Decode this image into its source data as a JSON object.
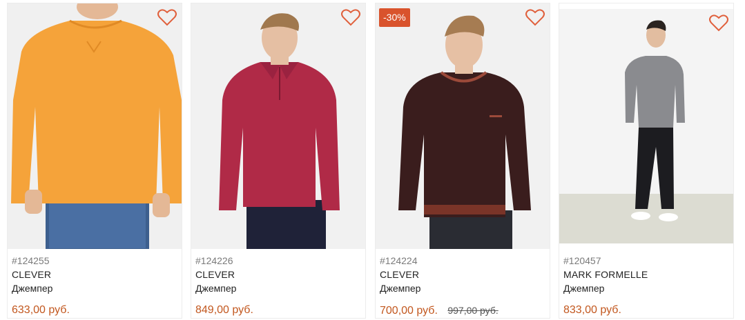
{
  "products": [
    {
      "sku": "#124255",
      "brand": "CLEVER",
      "type": "Джемпер",
      "price": "633,00 руб.",
      "old_price": "",
      "discount": "",
      "image": "orange-sweater-man",
      "icon": "heart-icon"
    },
    {
      "sku": "#124226",
      "brand": "CLEVER",
      "type": "Джемпер",
      "price": "849,00 руб.",
      "old_price": "",
      "discount": "",
      "image": "burgundy-polo-sweater-man",
      "icon": "heart-icon"
    },
    {
      "sku": "#124224",
      "brand": "CLEVER",
      "type": "Джемпер",
      "price": "700,00 руб.",
      "old_price": "997,00 руб.",
      "discount": "-30%",
      "image": "dark-brown-sweater-man",
      "icon": "heart-icon"
    },
    {
      "sku": "#120457",
      "brand": "MARK FORMELLE",
      "type": "Джемпер",
      "price": "833,00 руб.",
      "old_price": "",
      "discount": "",
      "image": "grey-sweater-man-full-length",
      "icon": "heart-icon"
    }
  ],
  "colors": {
    "accent": "#d9532c",
    "price": "#c2571e",
    "heart": "#e0603c"
  }
}
